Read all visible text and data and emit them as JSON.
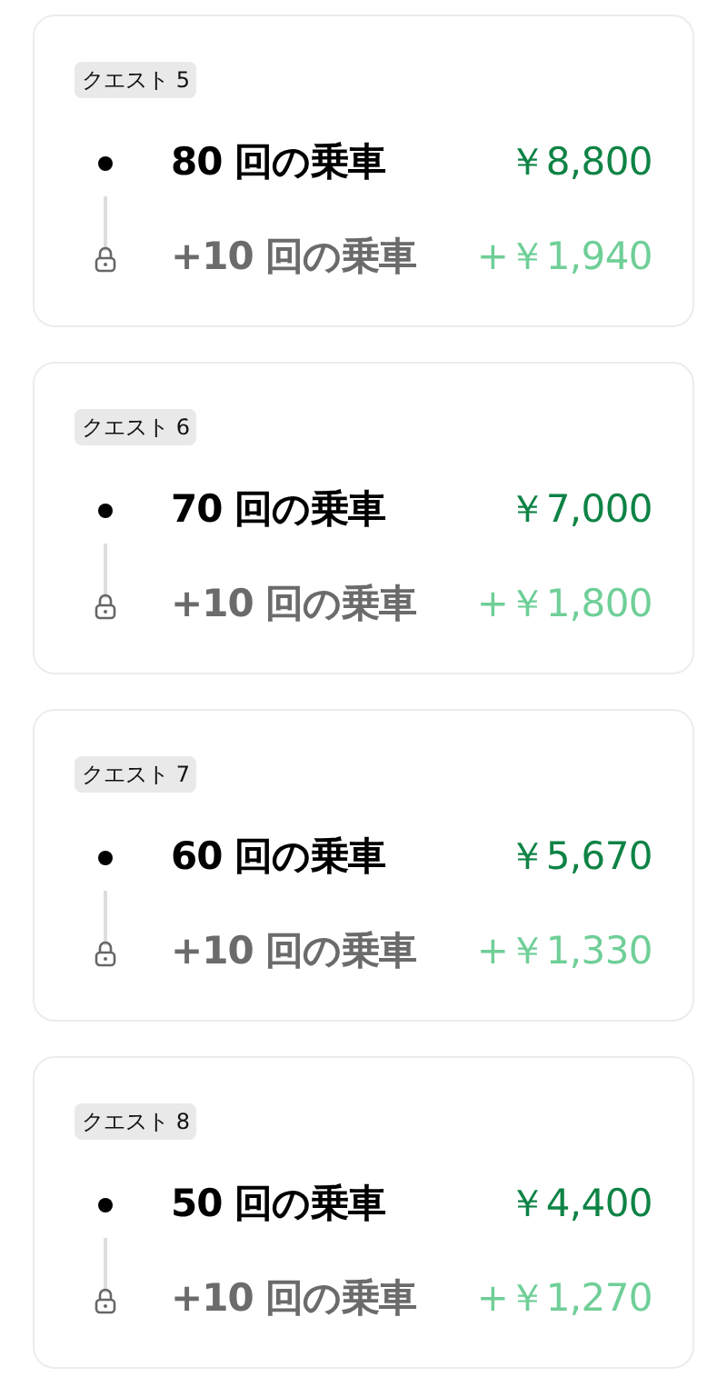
{
  "quests": [
    {
      "tag": "クエスト 5",
      "tiers": [
        {
          "kind": "current",
          "label": "80 回の乗車",
          "reward": "￥8,800"
        },
        {
          "kind": "locked",
          "label": "+10 回の乗車",
          "reward": "+￥1,940"
        }
      ]
    },
    {
      "tag": "クエスト 6",
      "tiers": [
        {
          "kind": "current",
          "label": "70 回の乗車",
          "reward": "￥7,000"
        },
        {
          "kind": "locked",
          "label": "+10 回の乗車",
          "reward": "+￥1,800"
        }
      ]
    },
    {
      "tag": "クエスト 7",
      "tiers": [
        {
          "kind": "current",
          "label": "60 回の乗車",
          "reward": "￥5,670"
        },
        {
          "kind": "locked",
          "label": "+10 回の乗車",
          "reward": "+￥1,330"
        }
      ]
    },
    {
      "tag": "クエスト 8",
      "tiers": [
        {
          "kind": "current",
          "label": "50 回の乗車",
          "reward": "￥4,400"
        },
        {
          "kind": "locked",
          "label": "+10 回の乗車",
          "reward": "+￥1,270"
        }
      ]
    }
  ]
}
